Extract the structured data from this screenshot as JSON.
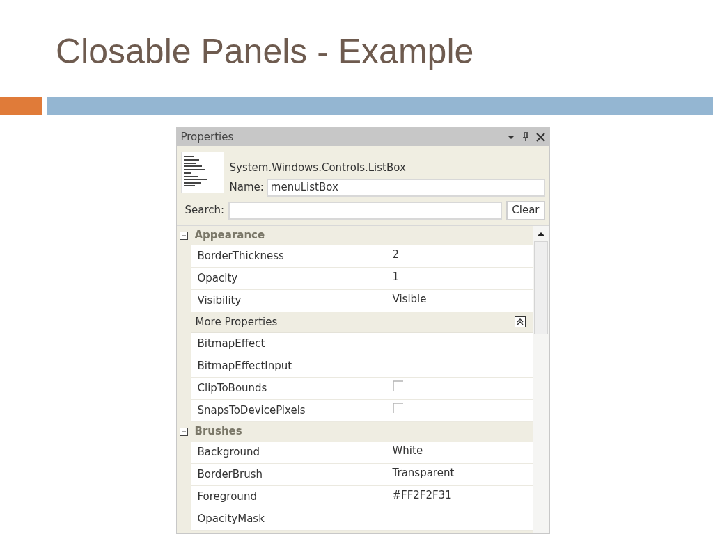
{
  "slide": {
    "title": "Closable Panels - Example"
  },
  "panel": {
    "title": "Properties",
    "type_name": "System.Windows.Controls.ListBox",
    "name_label": "Name:",
    "name_value": "menuListBox",
    "search_label": "Search:",
    "clear_button": "Clear",
    "categories": [
      {
        "label": "Appearance",
        "expanded": true,
        "rows": [
          {
            "kind": "text",
            "name": "BorderThickness",
            "value": "2"
          },
          {
            "kind": "text",
            "name": "Opacity",
            "value": "1"
          },
          {
            "kind": "text",
            "name": "Visibility",
            "value": "Visible"
          },
          {
            "kind": "subheader",
            "name": "More Properties",
            "expanded": true
          },
          {
            "kind": "text",
            "name": "BitmapEffect"
          },
          {
            "kind": "text",
            "name": "BitmapEffectInput"
          },
          {
            "kind": "checkbox",
            "name": "ClipToBounds",
            "checked": false
          },
          {
            "kind": "checkbox",
            "name": "SnapsToDevicePixels",
            "checked": false
          }
        ]
      },
      {
        "label": "Brushes",
        "expanded": true,
        "rows": [
          {
            "kind": "text",
            "name": "Background",
            "value": "White"
          },
          {
            "kind": "text",
            "name": "BorderBrush",
            "value": "Transparent"
          },
          {
            "kind": "text",
            "name": "Foreground",
            "value": "#FF2F2F31"
          },
          {
            "kind": "text",
            "name": "OpacityMask"
          }
        ]
      }
    ]
  }
}
